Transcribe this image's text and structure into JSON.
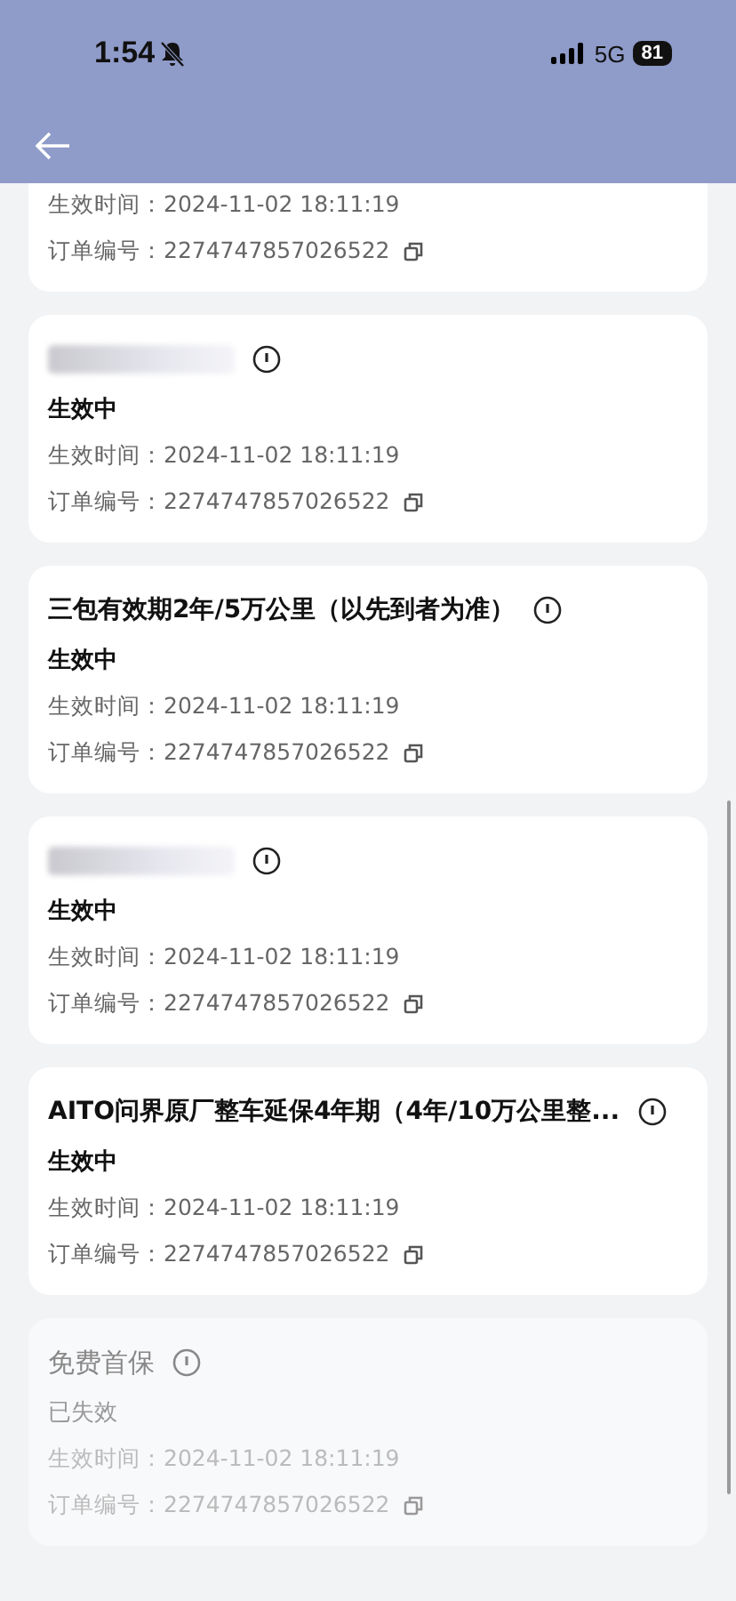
{
  "status_bar": {
    "time": "1:54",
    "network": "5G",
    "battery": "81",
    "silent": true
  },
  "cards": [
    {
      "cut": true,
      "active": true,
      "time_label": "生效时间：",
      "time": "2024-11-02 18:11:19",
      "order_label": "订单编号：",
      "order": "2274747857026522"
    },
    {
      "cut": false,
      "redacted": true,
      "active": true,
      "status": "生效中",
      "time_label": "生效时间：",
      "time": "2024-11-02 18:11:19",
      "order_label": "订单编号：",
      "order": "2274747857026522"
    },
    {
      "cut": false,
      "redacted": false,
      "title": "三包有效期2年/5万公里（以先到者为准）",
      "active": true,
      "status": "生效中",
      "time_label": "生效时间：",
      "time": "2024-11-02 18:11:19",
      "order_label": "订单编号：",
      "order": "2274747857026522"
    },
    {
      "cut": false,
      "redacted": true,
      "active": true,
      "status": "生效中",
      "time_label": "生效时间：",
      "time": "2024-11-02 18:11:19",
      "order_label": "订单编号：",
      "order": "2274747857026522"
    },
    {
      "cut": false,
      "redacted": false,
      "title": "AITO问界原厂整车延保4年期（4年/10万公里整...",
      "active": true,
      "status": "生效中",
      "time_label": "生效时间：",
      "time": "2024-11-02 18:11:19",
      "order_label": "订单编号：",
      "order": "2274747857026522"
    },
    {
      "cut": false,
      "redacted": false,
      "title": "免费首保",
      "active": false,
      "status": "已失效",
      "time_label": "生效时间：",
      "time": "2024-11-02 18:11:19",
      "order_label": "订单编号：",
      "order": "2274747857026522"
    }
  ]
}
